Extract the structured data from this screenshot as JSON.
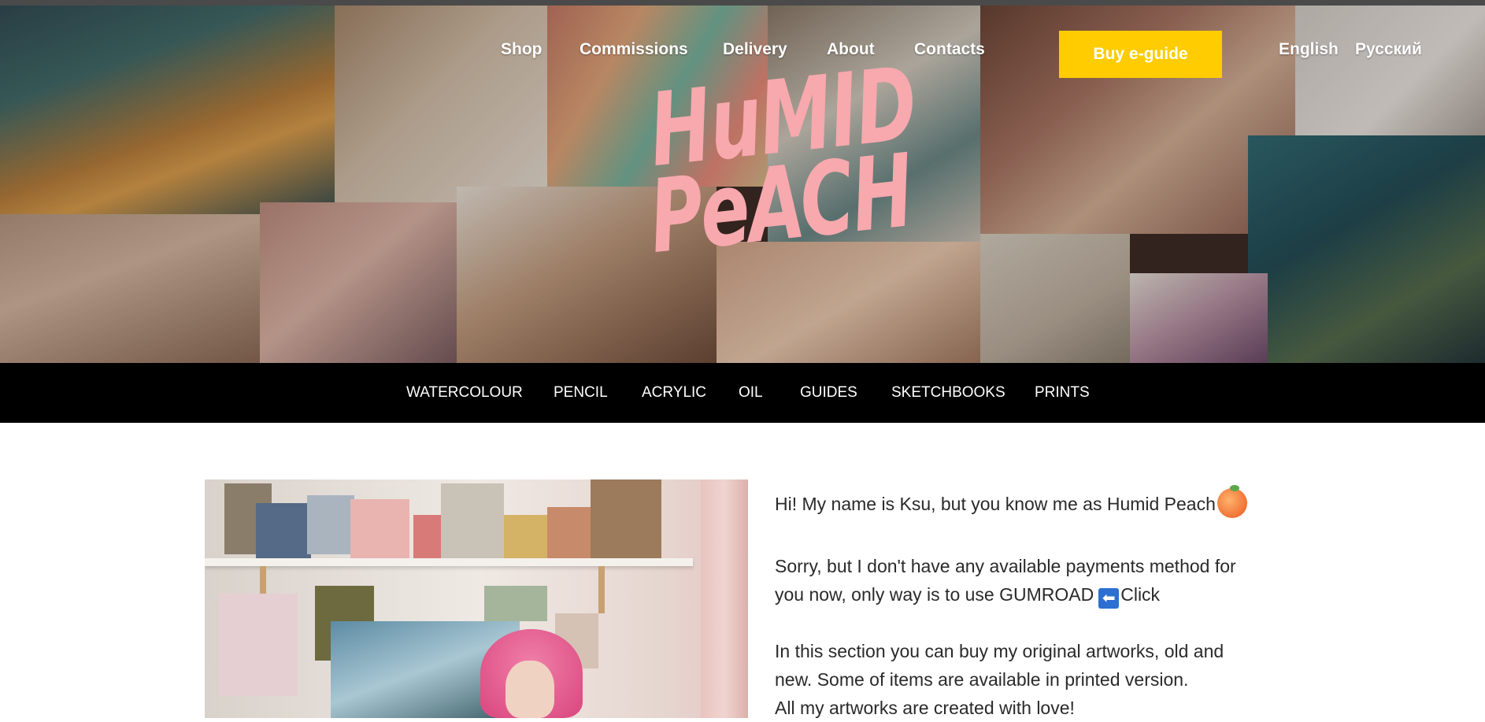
{
  "header": {
    "nav": [
      {
        "id": "shop",
        "label": "Shop"
      },
      {
        "id": "commissions",
        "label": "Commissions"
      },
      {
        "id": "delivery",
        "label": "Delivery"
      },
      {
        "id": "about",
        "label": "About"
      },
      {
        "id": "contacts",
        "label": "Contacts"
      }
    ],
    "buy_button": "Buy e-guide",
    "languages": [
      "English",
      "Русский"
    ],
    "logo_line1": "HuMID",
    "logo_line2": "PeACH"
  },
  "categories": [
    "WATERCOLOUR",
    "PENCIL",
    "ACRYLIC",
    "OIL",
    "GUIDES",
    "SKETCHBOOKS",
    "PRINTS"
  ],
  "intro": {
    "p1": "Hi! My name is Ksu, but you know me as Humid Peach",
    "p2_line1": "Sorry, but I don't have any available payments method for",
    "p2_line2_a": "you now, only way is to use GUMROAD",
    "arrow": "⬅",
    "p2_line2_b": "Click",
    "p3_line1": "In this section you can buy my original artworks, old and",
    "p3_line2": "new. Some of items are available in printed version.",
    "p3_line3": "All my artworks are created with love!"
  },
  "colors": {
    "buy_button_bg": "#fecc00",
    "logo": "#f7a9ad",
    "category_bar": "#000000"
  }
}
